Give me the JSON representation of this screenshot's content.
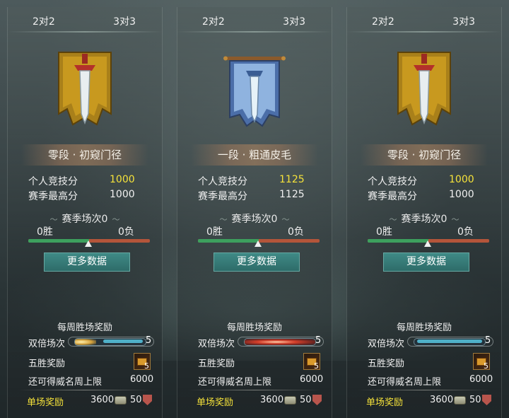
{
  "tab_left": "2对2",
  "tab_right": "3对3",
  "panels": [
    {
      "rank": "零段 · 初窥门径",
      "score_label": "个人竞技分",
      "score": "1000",
      "best_label": "赛季最高分",
      "best": "1000",
      "season": "赛季场次0",
      "wins": "0胜",
      "losses": "0负",
      "more": "更多数据",
      "weekly_title": "每周胜场奖励",
      "double_label": "双倍场次",
      "double_count": "5",
      "five_win_label": "五胜奖励",
      "five_win_count": "5",
      "fame_label": "还可得威名周上限",
      "fame_value": "6000",
      "single_label": "单场奖励",
      "single_coin": "3600",
      "single_shield": "50",
      "emblem": "gold-banner-sword"
    },
    {
      "rank": "一段 · 粗通皮毛",
      "score_label": "个人竞技分",
      "score": "1125",
      "best_label": "赛季最高分",
      "best": "1125",
      "season": "赛季场次0",
      "wins": "0胜",
      "losses": "0负",
      "more": "更多数据",
      "weekly_title": "每周胜场奖励",
      "double_label": "双倍场次",
      "double_count": "5",
      "five_win_label": "五胜奖励",
      "five_win_count": "5",
      "fame_label": "还可得威名周上限",
      "fame_value": "6000",
      "single_label": "单场奖励",
      "single_coin": "3600",
      "single_shield": "50",
      "emblem": "blue-banner-sword"
    },
    {
      "rank": "零段 · 初窥门径",
      "score_label": "个人竞技分",
      "score": "1000",
      "best_label": "赛季最高分",
      "best": "1000",
      "season": "赛季场次0",
      "wins": "0胜",
      "losses": "0负",
      "more": "更多数据",
      "weekly_title": "每周胜场奖励",
      "double_label": "双倍场次",
      "double_count": "5",
      "five_win_label": "五胜奖励",
      "five_win_count": "5",
      "fame_label": "还可得威名周上限",
      "fame_value": "6000",
      "single_label": "单场奖励",
      "single_coin": "3600",
      "single_shield": "50",
      "emblem": "gold-banner-sword"
    }
  ],
  "colors": {
    "highlight": "#f5e23a",
    "win_bar": "#3da05e",
    "loss_bar": "#b4553a",
    "button": "#2e6c69"
  }
}
